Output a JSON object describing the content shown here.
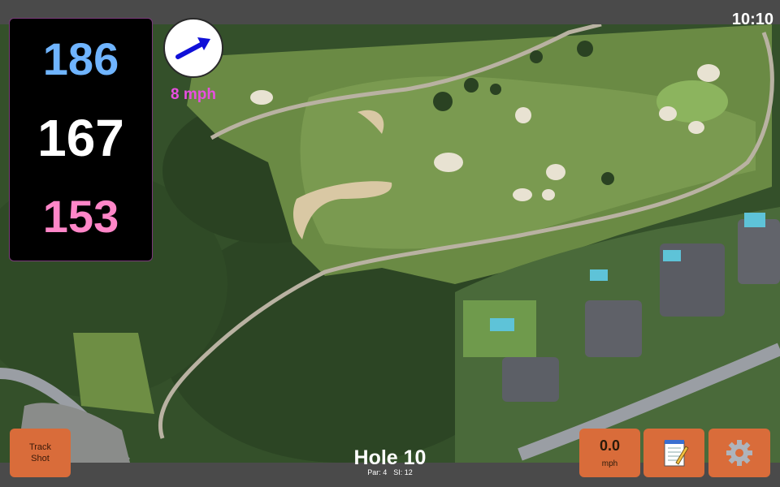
{
  "status": {
    "time": "10:10"
  },
  "distances": {
    "back": "186",
    "middle": "167",
    "front": "153"
  },
  "wind": {
    "speed": "8 mph",
    "icon": "wind-direction-arrow-icon"
  },
  "hole": {
    "title": "Hole 10",
    "par_label": "Par: 4",
    "si_label": "SI: 12"
  },
  "buttons": {
    "track_shot_line1": "Track",
    "track_shot_line2": "Shot",
    "speed_value": "0.0",
    "speed_unit": "mph",
    "notes_icon": "notepad-icon",
    "settings_icon": "gear-icon"
  },
  "colors": {
    "back_distance": "#6fb4ff",
    "middle_distance": "#ffffff",
    "front_distance": "#ff86c8",
    "wind_speed_text": "#e84fe0",
    "button_bg": "#d96c3a"
  }
}
